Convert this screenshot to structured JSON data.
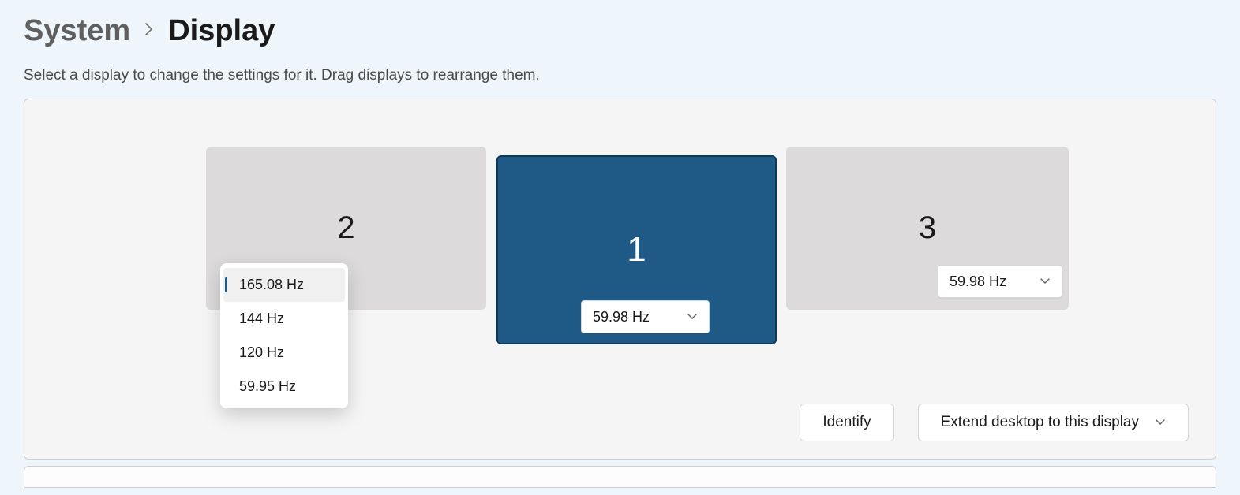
{
  "breadcrumb": {
    "parent": "System",
    "current": "Display"
  },
  "description": "Select a display to change the settings for it. Drag displays to rearrange them.",
  "monitors": {
    "m2": {
      "label": "2"
    },
    "m1": {
      "label": "1"
    },
    "m3": {
      "label": "3"
    }
  },
  "hz_selects": {
    "m1": {
      "value": "59.98 Hz"
    },
    "m3": {
      "value": "59.98 Hz"
    }
  },
  "dropdown": {
    "items": [
      "165.08 Hz",
      "144 Hz",
      "120 Hz",
      "59.95 Hz"
    ]
  },
  "buttons": {
    "identify": "Identify",
    "extend": "Extend desktop to this display"
  }
}
